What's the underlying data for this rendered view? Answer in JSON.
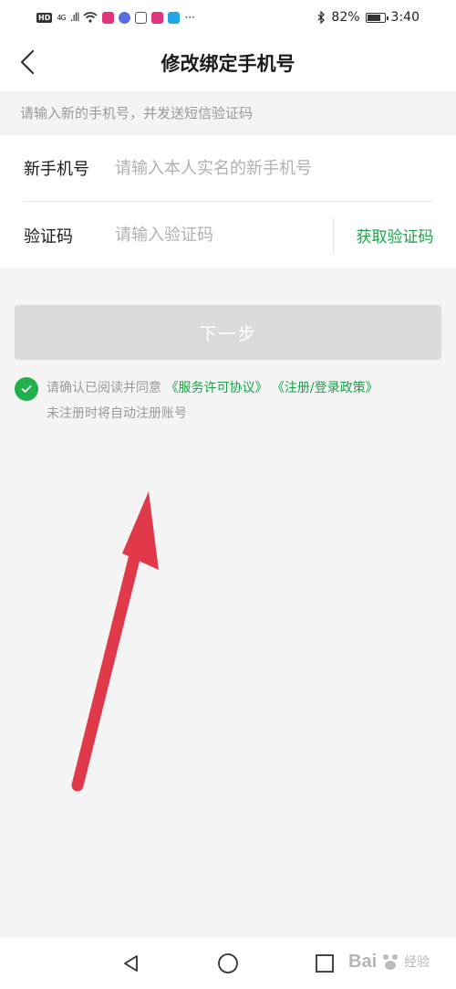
{
  "status_bar": {
    "hd": "HD",
    "network": "4G",
    "signal": ".ıll",
    "more": "···",
    "battery_percent": "82%",
    "time": "3:40"
  },
  "header": {
    "title": "修改绑定手机号"
  },
  "hint": "请输入新的手机号，并发送短信验证码",
  "form": {
    "phone_label": "新手机号",
    "phone_placeholder": "请输入本人实名的新手机号",
    "code_label": "验证码",
    "code_placeholder": "请输入验证码",
    "get_code_label": "获取验证码"
  },
  "next_button": "下一步",
  "agreement": {
    "prefix": "请确认已阅读并同意",
    "service_link": "《服务许可协议》",
    "policy_link": "《注册/登录政策》",
    "note": "未注册时将自动注册账号"
  },
  "watermark": {
    "brand": "Bai",
    "suffix": "经验"
  },
  "colors": {
    "accent_green": "#1aa34a",
    "button_disabled": "#dadada",
    "annotation_arrow": "#e0394a"
  }
}
